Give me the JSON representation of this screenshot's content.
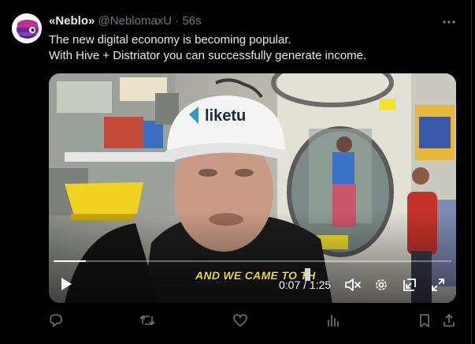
{
  "tweet": {
    "author_name": "«Neblo»",
    "author_handle": "@NeblomaxU",
    "separator": "·",
    "time": "56s",
    "text_lines": [
      "The new digital economy is becoming popular.",
      "With Hive + Distriator you can successfully generate income."
    ]
  },
  "video": {
    "cap_logo_text": "liketu",
    "caption": "AND WE CAME TO TH",
    "current_time": "0:07",
    "time_separator": " / ",
    "duration": "1:25",
    "progress_fraction": 0.082
  },
  "icons": {
    "more": "more-dots-icon",
    "play": "play-icon",
    "mute": "volume-muted-icon",
    "settings": "settings-gear-icon",
    "pip": "picture-in-picture-icon",
    "fullscreen": "fullscreen-icon",
    "reply": "reply-icon",
    "retweet": "retweet-icon",
    "like": "like-heart-icon",
    "views": "views-bar-icon",
    "bookmark": "bookmark-icon",
    "share": "share-icon"
  },
  "colors": {
    "background": "#000000",
    "text": "#e7e9ea",
    "muted": "#71767b",
    "caption_yellow": "#f2dd2f"
  }
}
